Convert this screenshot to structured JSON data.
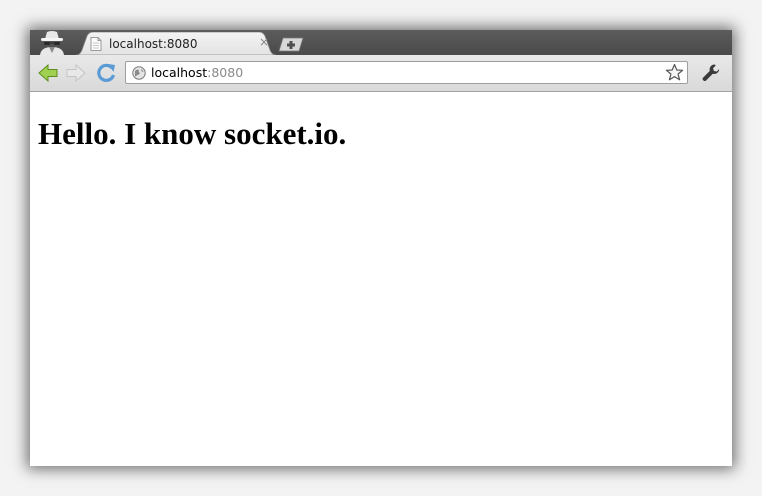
{
  "tab": {
    "title": "localhost:8080",
    "close_glyph": "×"
  },
  "omnibox": {
    "host": "localhost",
    "port": ":8080"
  },
  "page": {
    "heading": "Hello. I know socket.io."
  },
  "icons": {
    "incognito": "incognito-icon",
    "favicon": "page-icon",
    "back": "back-arrow-icon",
    "forward": "forward-arrow-icon",
    "reload": "reload-icon",
    "globe": "globe-icon",
    "star": "star-icon",
    "wrench": "wrench-icon",
    "newtab": "plus-icon"
  },
  "colors": {
    "tabstrip": "#4f4f4f",
    "toolbar": "#e0e0e0",
    "back_arrow": "#8cc63f",
    "reload": "#5b9bd5"
  }
}
